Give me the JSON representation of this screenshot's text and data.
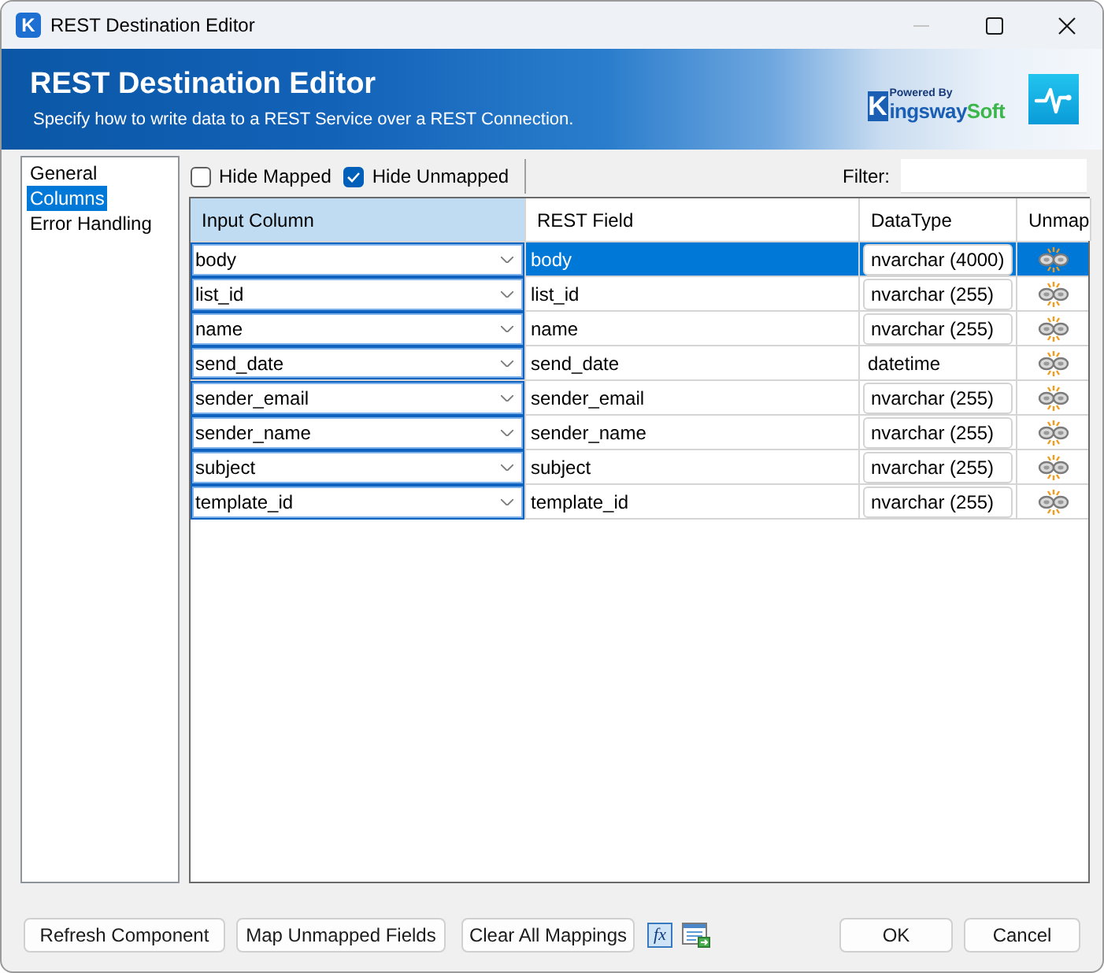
{
  "window": {
    "icon_glyph": "K",
    "title": "REST Destination Editor",
    "controls": [
      {
        "kind": "minimize",
        "disabled": true
      },
      {
        "kind": "maximize",
        "disabled": false
      },
      {
        "kind": "close",
        "disabled": false
      }
    ]
  },
  "banner": {
    "title": "REST Destination Editor",
    "subtitle": "Specify how to write data to a REST Service over a REST Connection.",
    "logo": {
      "tagline": "Powered By",
      "initial": "K",
      "name": "ingsway",
      "suffix": "Soft"
    }
  },
  "sidebar": {
    "items": [
      {
        "label": "General",
        "selected": false
      },
      {
        "label": "Columns",
        "selected": true
      },
      {
        "label": "Error Handling",
        "selected": false
      }
    ]
  },
  "toolbar": {
    "options": [
      {
        "label": "Hide Mapped",
        "checked": false
      },
      {
        "label": "Hide Unmapped",
        "checked": true
      }
    ],
    "filter": {
      "label": "Filter:"
    }
  },
  "table": {
    "columns": [
      {
        "label": "Input Column",
        "selected": true
      },
      {
        "label": "REST Field",
        "selected": false
      },
      {
        "label": "DataType",
        "selected": false
      },
      {
        "label": "Unmap",
        "selected": false
      }
    ],
    "rows": [
      {
        "input_column": "body",
        "rest_field": "body",
        "data_type": {
          "kind": "field",
          "value": "nvarchar (4000)"
        },
        "selected": true
      },
      {
        "input_column": "list_id",
        "rest_field": "list_id",
        "data_type": {
          "kind": "field",
          "value": "nvarchar (255)"
        },
        "selected": false
      },
      {
        "input_column": "name",
        "rest_field": "name",
        "data_type": {
          "kind": "field",
          "value": "nvarchar (255)"
        },
        "selected": false
      },
      {
        "input_column": "send_date",
        "rest_field": "send_date",
        "data_type": {
          "kind": "text",
          "value": "datetime"
        },
        "selected": false
      },
      {
        "input_column": "sender_email",
        "rest_field": "sender_email",
        "data_type": {
          "kind": "field",
          "value": "nvarchar (255)"
        },
        "selected": false
      },
      {
        "input_column": "sender_name",
        "rest_field": "sender_name",
        "data_type": {
          "kind": "field",
          "value": "nvarchar (255)"
        },
        "selected": false
      },
      {
        "input_column": "subject",
        "rest_field": "subject",
        "data_type": {
          "kind": "field",
          "value": "nvarchar (255)"
        },
        "selected": false
      },
      {
        "input_column": "template_id",
        "rest_field": "template_id",
        "data_type": {
          "kind": "field",
          "value": "nvarchar (255)"
        },
        "selected": false
      }
    ]
  },
  "footer": {
    "buttons": [
      {
        "label": "Refresh Component"
      },
      {
        "label": "Map Unmapped Fields"
      },
      {
        "label": "Clear All Mappings"
      }
    ],
    "formula_glyph": "fx",
    "dialog_buttons": [
      {
        "label": "OK"
      },
      {
        "label": "Cancel"
      }
    ]
  }
}
